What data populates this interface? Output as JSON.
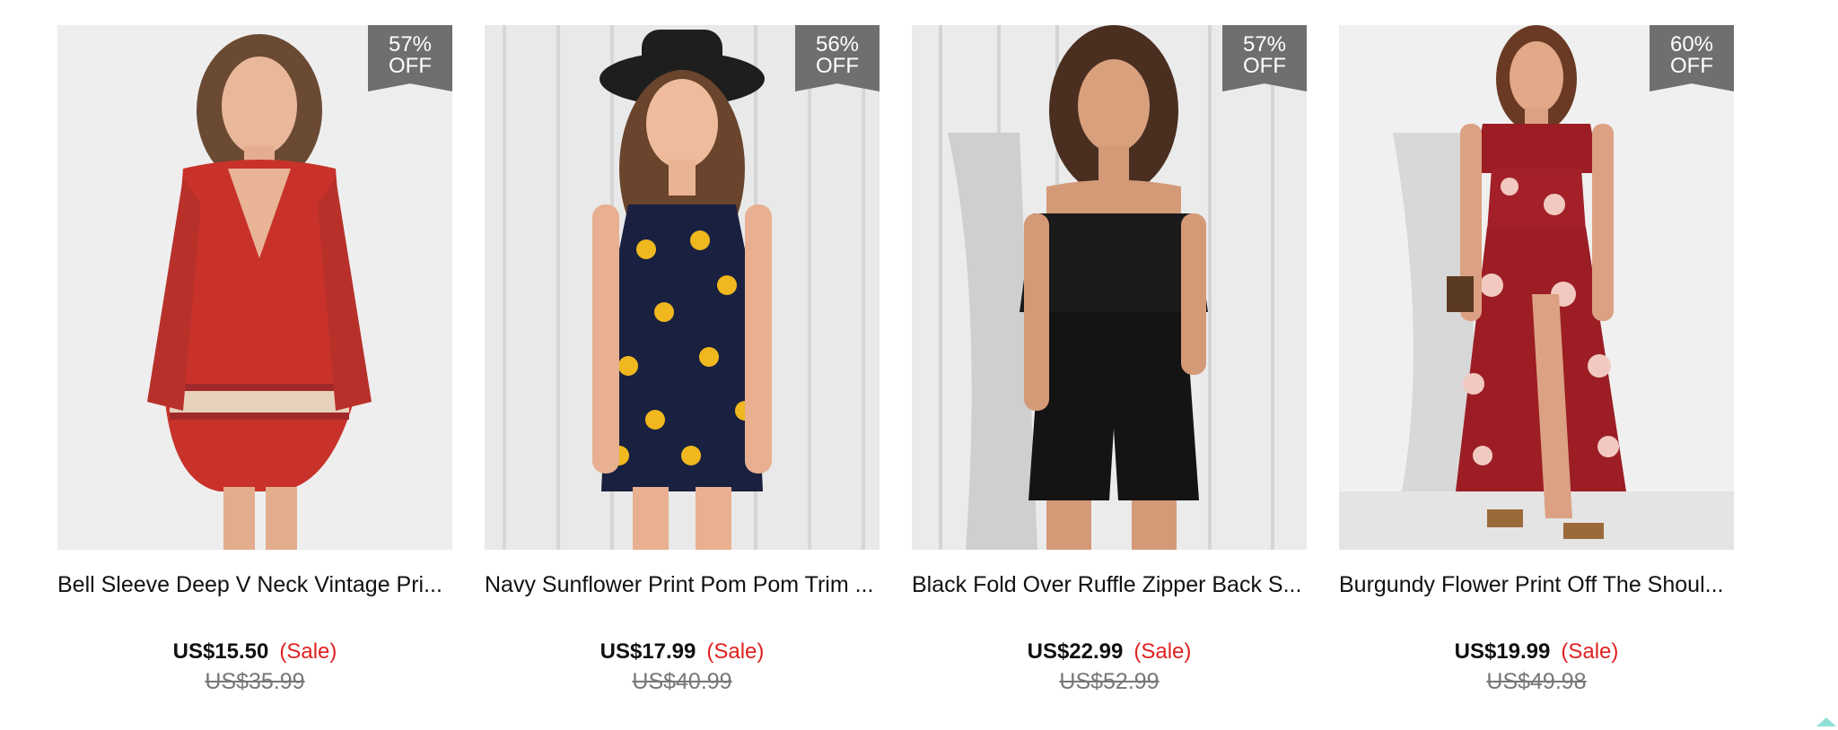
{
  "products": [
    {
      "discount_pct": "57%",
      "discount_off": "OFF",
      "title": "Bell Sleeve Deep V Neck Vintage Pri...",
      "price": "US$15.50",
      "sale_label": "(Sale)",
      "old_price": "US$35.99",
      "image": "red-print-romper-photo"
    },
    {
      "discount_pct": "56%",
      "discount_off": "OFF",
      "title": "Navy Sunflower Print Pom Pom Trim ...",
      "price": "US$17.99",
      "sale_label": "(Sale)",
      "old_price": "US$40.99",
      "image": "navy-sunflower-romper-photo"
    },
    {
      "discount_pct": "57%",
      "discount_off": "OFF",
      "title": "Black Fold Over Ruffle Zipper Back S...",
      "price": "US$22.99",
      "sale_label": "(Sale)",
      "old_price": "US$52.99",
      "image": "black-ruffle-romper-photo"
    },
    {
      "discount_pct": "60%",
      "discount_off": "OFF",
      "title": "Burgundy Flower Print Off The Shoul...",
      "price": "US$19.99",
      "sale_label": "(Sale)",
      "old_price": "US$49.98",
      "image": "burgundy-flower-dress-photo"
    }
  ],
  "colors": {
    "badge": "#6f6f6f",
    "sale": "#e02222",
    "old_price": "#777777",
    "back_to_top": "#8fe0d6"
  }
}
